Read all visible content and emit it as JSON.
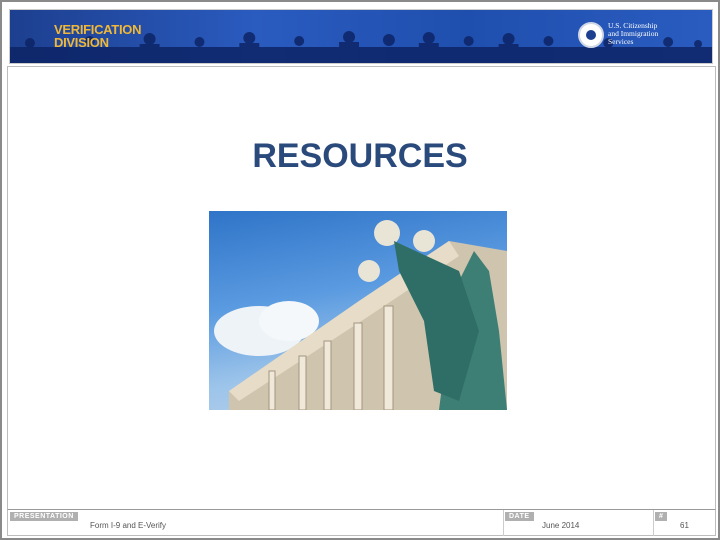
{
  "header": {
    "division_line1": "VERIFICATION",
    "division_line2": "DIVISION",
    "agency_line1": "U.S. Citizenship",
    "agency_line2": "and Immigration",
    "agency_line3": "Services"
  },
  "slide": {
    "title": "RESOURCES"
  },
  "footer": {
    "presentation_label": "PRESENTATION",
    "presentation_value": "Form I-9 and E-Verify",
    "date_label": "DATE",
    "date_value": "June 2014",
    "number_label": "#",
    "number_value": "61"
  },
  "colors": {
    "banner": "#1d3f8f",
    "division_text": "#f0b838",
    "title": "#2b4a7c"
  }
}
